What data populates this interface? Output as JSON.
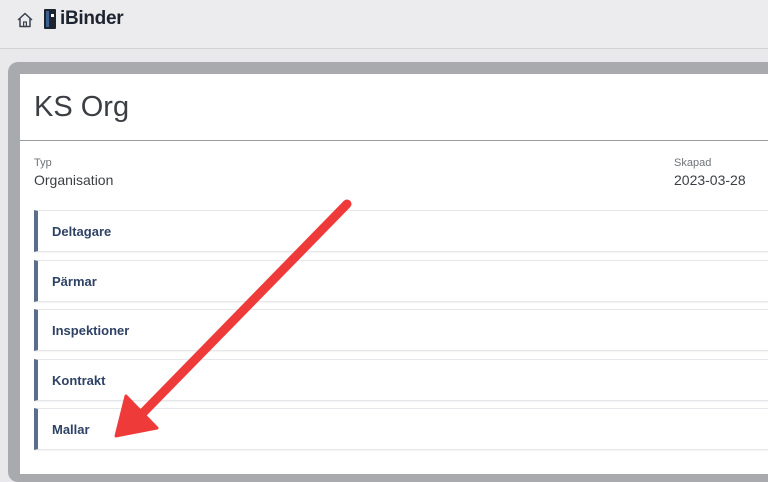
{
  "header": {
    "brand": "iBinder"
  },
  "page": {
    "title": "KS Org",
    "meta": [
      {
        "label": "Typ",
        "value": "Organisation"
      },
      {
        "label": "Skapad",
        "value": "2023-03-28"
      }
    ]
  },
  "sections": [
    {
      "label": "Deltagare"
    },
    {
      "label": "Pärmar"
    },
    {
      "label": "Inspektioner"
    },
    {
      "label": "Kontrakt"
    },
    {
      "label": "Mallar"
    }
  ],
  "colors": {
    "accent_bar": "#5a6e8b",
    "section_text": "#2f4265",
    "annotation_arrow": "#ef3a3a"
  }
}
